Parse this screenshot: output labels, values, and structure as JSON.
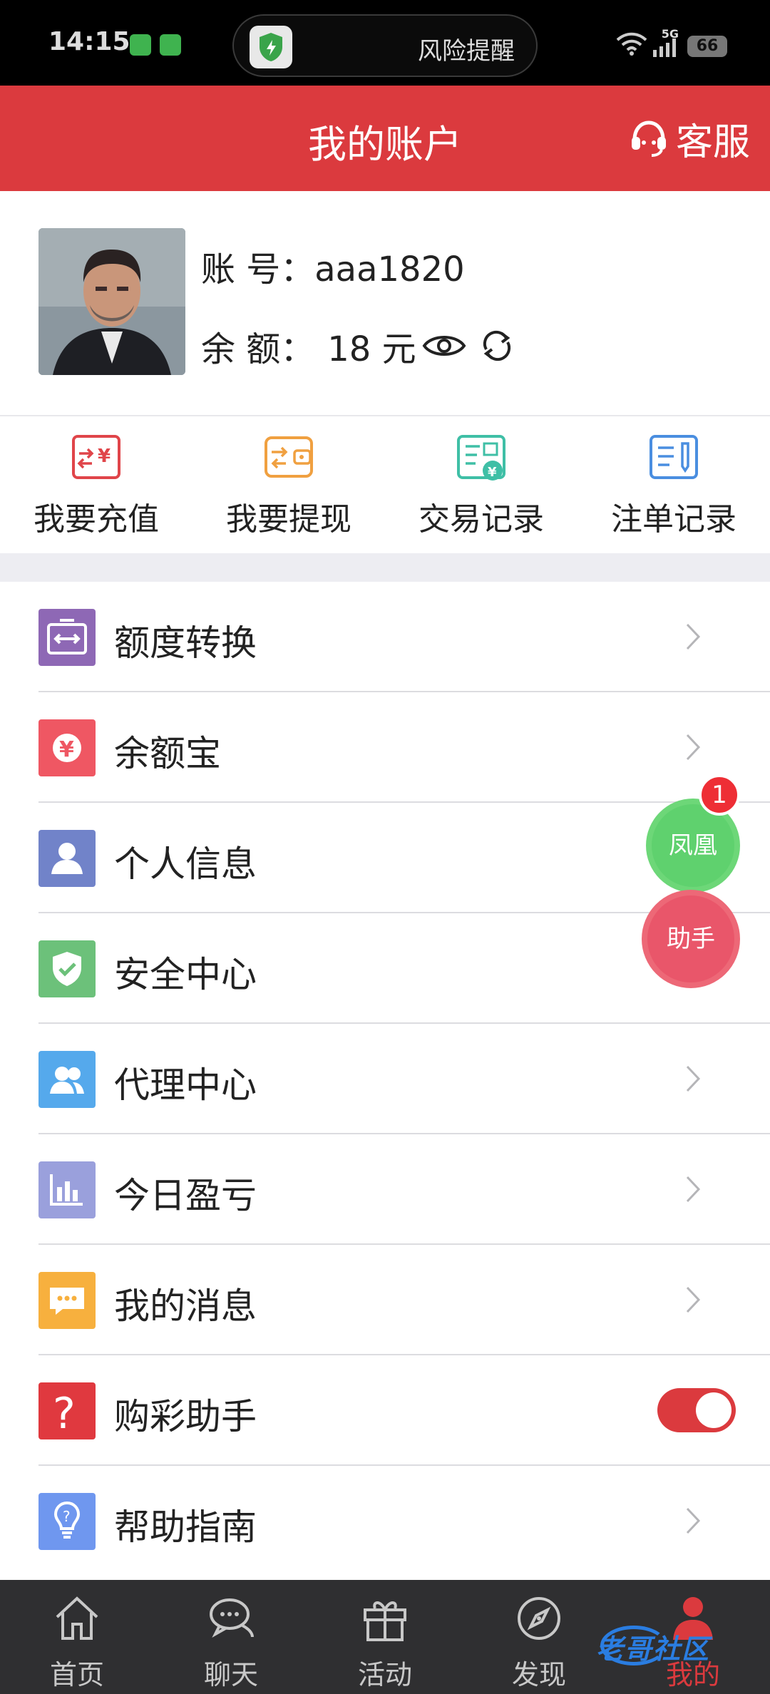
{
  "status_bar": {
    "time": "14:15",
    "alert": "风险提醒",
    "network": "5G",
    "battery": "66"
  },
  "header": {
    "title": "我的账户",
    "service_label": "客服"
  },
  "profile": {
    "account_label": "账 号：",
    "account_value": "aaa1820",
    "balance_label": "余 额：",
    "balance_value": "18 元"
  },
  "quick_actions": [
    {
      "label": "我要充值",
      "icon": "recharge-icon",
      "color": "#e0454a"
    },
    {
      "label": "我要提现",
      "icon": "withdraw-wallet-icon",
      "color": "#f0a040"
    },
    {
      "label": "交易记录",
      "icon": "transaction-record-icon",
      "color": "#3fbfa6"
    },
    {
      "label": "注单记录",
      "icon": "bet-record-icon",
      "color": "#4a8ee0"
    }
  ],
  "menu": [
    {
      "label": "额度转换",
      "icon": "transfer-icon",
      "color": "#8e68b5"
    },
    {
      "label": "余额宝",
      "icon": "yen-icon",
      "color": "#ef5763"
    },
    {
      "label": "个人信息",
      "icon": "user-icon",
      "color": "#7183c9"
    },
    {
      "label": "安全中心",
      "icon": "shield-check-icon",
      "color": "#6cc17a"
    },
    {
      "label": "代理中心",
      "icon": "group-icon",
      "color": "#55a9ec"
    },
    {
      "label": "今日盈亏",
      "icon": "bar-chart-icon",
      "color": "#9aa0dc"
    },
    {
      "label": "我的消息",
      "icon": "message-icon",
      "color": "#f7b03e"
    },
    {
      "label": "购彩助手",
      "icon": "question-icon",
      "color": "#e0393f",
      "toggle": true
    },
    {
      "label": "帮助指南",
      "icon": "bulb-icon",
      "color": "#6f97ef"
    }
  ],
  "floating": {
    "green_label": "凤凰",
    "badge_count": "1",
    "red_label": "助手"
  },
  "bottom_nav": [
    {
      "label": "首页",
      "icon": "home-icon"
    },
    {
      "label": "聊天",
      "icon": "chat-icon"
    },
    {
      "label": "活动",
      "icon": "gift-icon"
    },
    {
      "label": "发现",
      "icon": "compass-icon"
    },
    {
      "label": "我的",
      "icon": "person-icon",
      "active": true
    }
  ],
  "watermark": "老哥社区"
}
